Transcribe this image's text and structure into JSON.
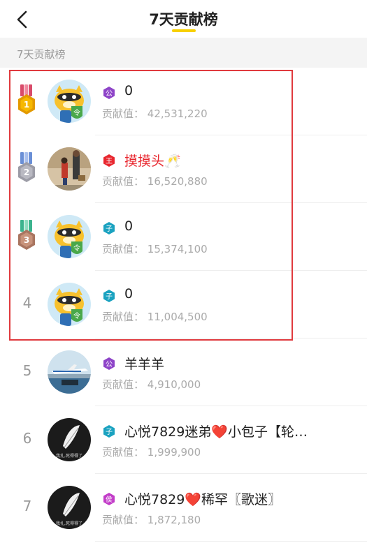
{
  "header": {
    "title": "7天贡献榜",
    "back_icon": "chevron-left-icon",
    "underline_color": "#f8d000"
  },
  "section": {
    "label": "7天贡献榜"
  },
  "contribution_label": "贡献值：",
  "entries": [
    {
      "rank": "1",
      "medal": "gold",
      "badge": "公",
      "badge_color": "#8e44c8",
      "name": "0",
      "name_color": "normal",
      "value": "42,531,220",
      "avatar": "yy-mascot"
    },
    {
      "rank": "2",
      "medal": "silver",
      "badge": "王",
      "badge_color": "#e8262e",
      "name": "摸摸头🥂",
      "name_color": "red",
      "value": "16,520,880",
      "avatar": "leon-photo"
    },
    {
      "rank": "3",
      "medal": "bronze",
      "badge": "子",
      "badge_color": "#1aa2c0",
      "name": "0",
      "name_color": "normal",
      "value": "15,374,100",
      "avatar": "yy-mascot"
    },
    {
      "rank": "4",
      "medal": "",
      "badge": "子",
      "badge_color": "#1aa2c0",
      "name": "0",
      "name_color": "normal",
      "value": "11,004,500",
      "avatar": "yy-mascot"
    },
    {
      "rank": "5",
      "medal": "",
      "badge": "公",
      "badge_color": "#8e44c8",
      "name": "羊羊羊",
      "name_color": "normal",
      "value": "4,910,000",
      "avatar": "airplane-photo"
    },
    {
      "rank": "6",
      "medal": "",
      "badge": "子",
      "badge_color": "#1aa2c0",
      "name": "心悦7829迷弟❤️小包子【轮…",
      "name_color": "normal",
      "value": "1,999,900",
      "avatar": "dark-feather"
    },
    {
      "rank": "7",
      "medal": "",
      "badge": "侯",
      "badge_color": "#c23cc8",
      "name": "心悦7829❤️稀罕〖歌迷〗",
      "name_color": "normal",
      "value": "1,872,180",
      "avatar": "dark-feather"
    }
  ],
  "avatar_caption": "我扎,死得得了",
  "highlight_color": "#e03a3e"
}
